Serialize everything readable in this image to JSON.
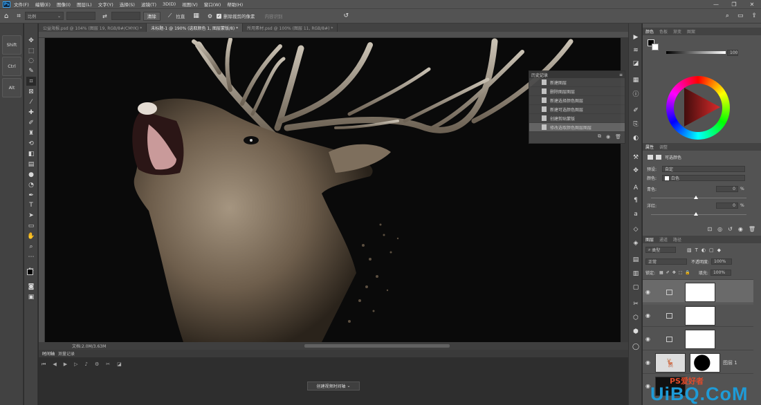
{
  "app": {
    "logo": "Ps"
  },
  "menu": [
    "文件(F)",
    "编辑(E)",
    "图像(I)",
    "图层(L)",
    "文字(Y)",
    "选择(S)",
    "滤镜(T)",
    "3D(D)",
    "视图(V)",
    "窗口(W)",
    "帮助(H)"
  ],
  "window_controls": [
    "—",
    "❐",
    "✕"
  ],
  "options": {
    "ratio": "比例",
    "clear": "清除",
    "straighten": "拉直",
    "delete_crop": "删除裁剪的像素",
    "content_aware": "内容识别"
  },
  "modifier_keys": [
    "Shift",
    "Ctrl",
    "Alt"
  ],
  "tabs": [
    {
      "label": "公益海报.psd @ 104% (图层 19, RGB/8#/CMYK) *",
      "active": false
    },
    {
      "label": "未标题-1 @ 190% (选取颜色 1, 图层蒙版/8) *",
      "active": true
    },
    {
      "label": "所用素材.psd @ 100% (图层 11, RGB/8#) *",
      "active": false
    }
  ],
  "status": {
    "doc": "文档:2.0M/3.63M"
  },
  "timeline": {
    "tabs": [
      "时间轴",
      "测量记录"
    ],
    "create_button": "创建视频时间轴"
  },
  "history": {
    "title": "历史记录",
    "items": [
      {
        "label": "新建图层",
        "selected": false
      },
      {
        "label": "删除图层图层",
        "selected": false
      },
      {
        "label": "新建选择颜色图层",
        "selected": false
      },
      {
        "label": "新建可选颜色图层",
        "selected": false
      },
      {
        "label": "创建剪贴蒙版",
        "selected": false
      },
      {
        "label": "修改选取颜色图层图层",
        "selected": true
      }
    ]
  },
  "color_panel": {
    "tabs": [
      "颜色",
      "色板",
      "渐变",
      "图案"
    ],
    "value": "100"
  },
  "properties": {
    "tabs": [
      "属性",
      "调整"
    ],
    "title": "可选颜色",
    "preset_label": "预设:",
    "preset_value": "自定",
    "colors_label": "颜色:",
    "colors_value": "白色",
    "cyan_label": "青色:",
    "cyan_value": "0",
    "magenta_label": "洋红:",
    "magenta_value": "0",
    "percent": "%"
  },
  "layers": {
    "tabs": [
      "图层",
      "通道",
      "路径"
    ],
    "filter": "类型",
    "blend": "正常",
    "opacity_label": "不透明度:",
    "opacity": "100%",
    "lock_label": "锁定:",
    "fill_label": "填充:",
    "fill": "100%",
    "layer_names": [
      "",
      "",
      "",
      "图层 1"
    ]
  },
  "watermark": {
    "main": "UiBQ.CoM",
    "sub": "PS爱好者"
  },
  "colors": {
    "accent": "#1e9bd7",
    "panel": "#535353",
    "canvas": "#0a0a0a"
  }
}
